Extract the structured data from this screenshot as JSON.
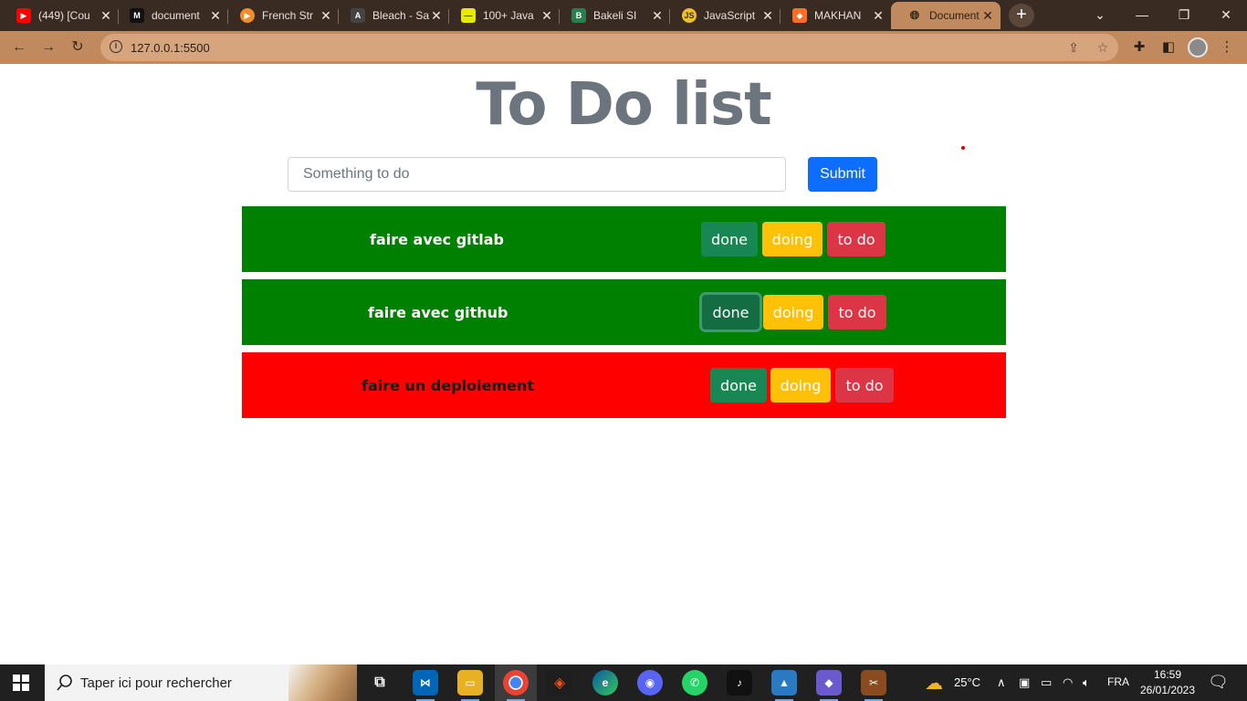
{
  "browser": {
    "tabs": [
      {
        "title": "(449) [Cou",
        "favicon": "youtube-icon",
        "color": "#ff0000"
      },
      {
        "title": "document",
        "favicon": "medium-icon",
        "color": "#111111"
      },
      {
        "title": "French Str",
        "favicon": "play-icon",
        "color": "#f28c28"
      },
      {
        "title": "Bleach - Sa",
        "favicon": "manga-icon",
        "color": "#444444"
      },
      {
        "title": "100+ Java",
        "favicon": "site-icon",
        "color": "#e8e800"
      },
      {
        "title": "Bakeli SI",
        "favicon": "bakeli-icon",
        "color": "#2a7d4f"
      },
      {
        "title": "JavaScript",
        "favicon": "js-icon",
        "color": "#f0c020"
      },
      {
        "title": "MAKHAN",
        "favicon": "gitlab-icon",
        "color": "#fc6d26"
      },
      {
        "title": "Document",
        "favicon": "globe-icon",
        "color": "#555555",
        "active": true
      }
    ],
    "url": "127.0.0.1:5500"
  },
  "page": {
    "heading": "To Do list",
    "input_placeholder": "Something to do",
    "submit_label": "Submit",
    "tasks": [
      {
        "label": "faire avec gitlab",
        "status_color": "#008000",
        "text_color": "#ffffff"
      },
      {
        "label": "faire avec github",
        "status_color": "#008000",
        "text_color": "#ffffff"
      },
      {
        "label": "faire un deploiement",
        "status_color": "#ff0000",
        "text_color": "#1a1a1a"
      }
    ],
    "button_labels": {
      "done": "done",
      "doing": "doing",
      "todo": "to do"
    }
  },
  "taskbar": {
    "search_placeholder": "Taper ici pour rechercher",
    "weather": "25°C",
    "language": "FRA",
    "time": "16:59",
    "date": "26/01/2023"
  }
}
